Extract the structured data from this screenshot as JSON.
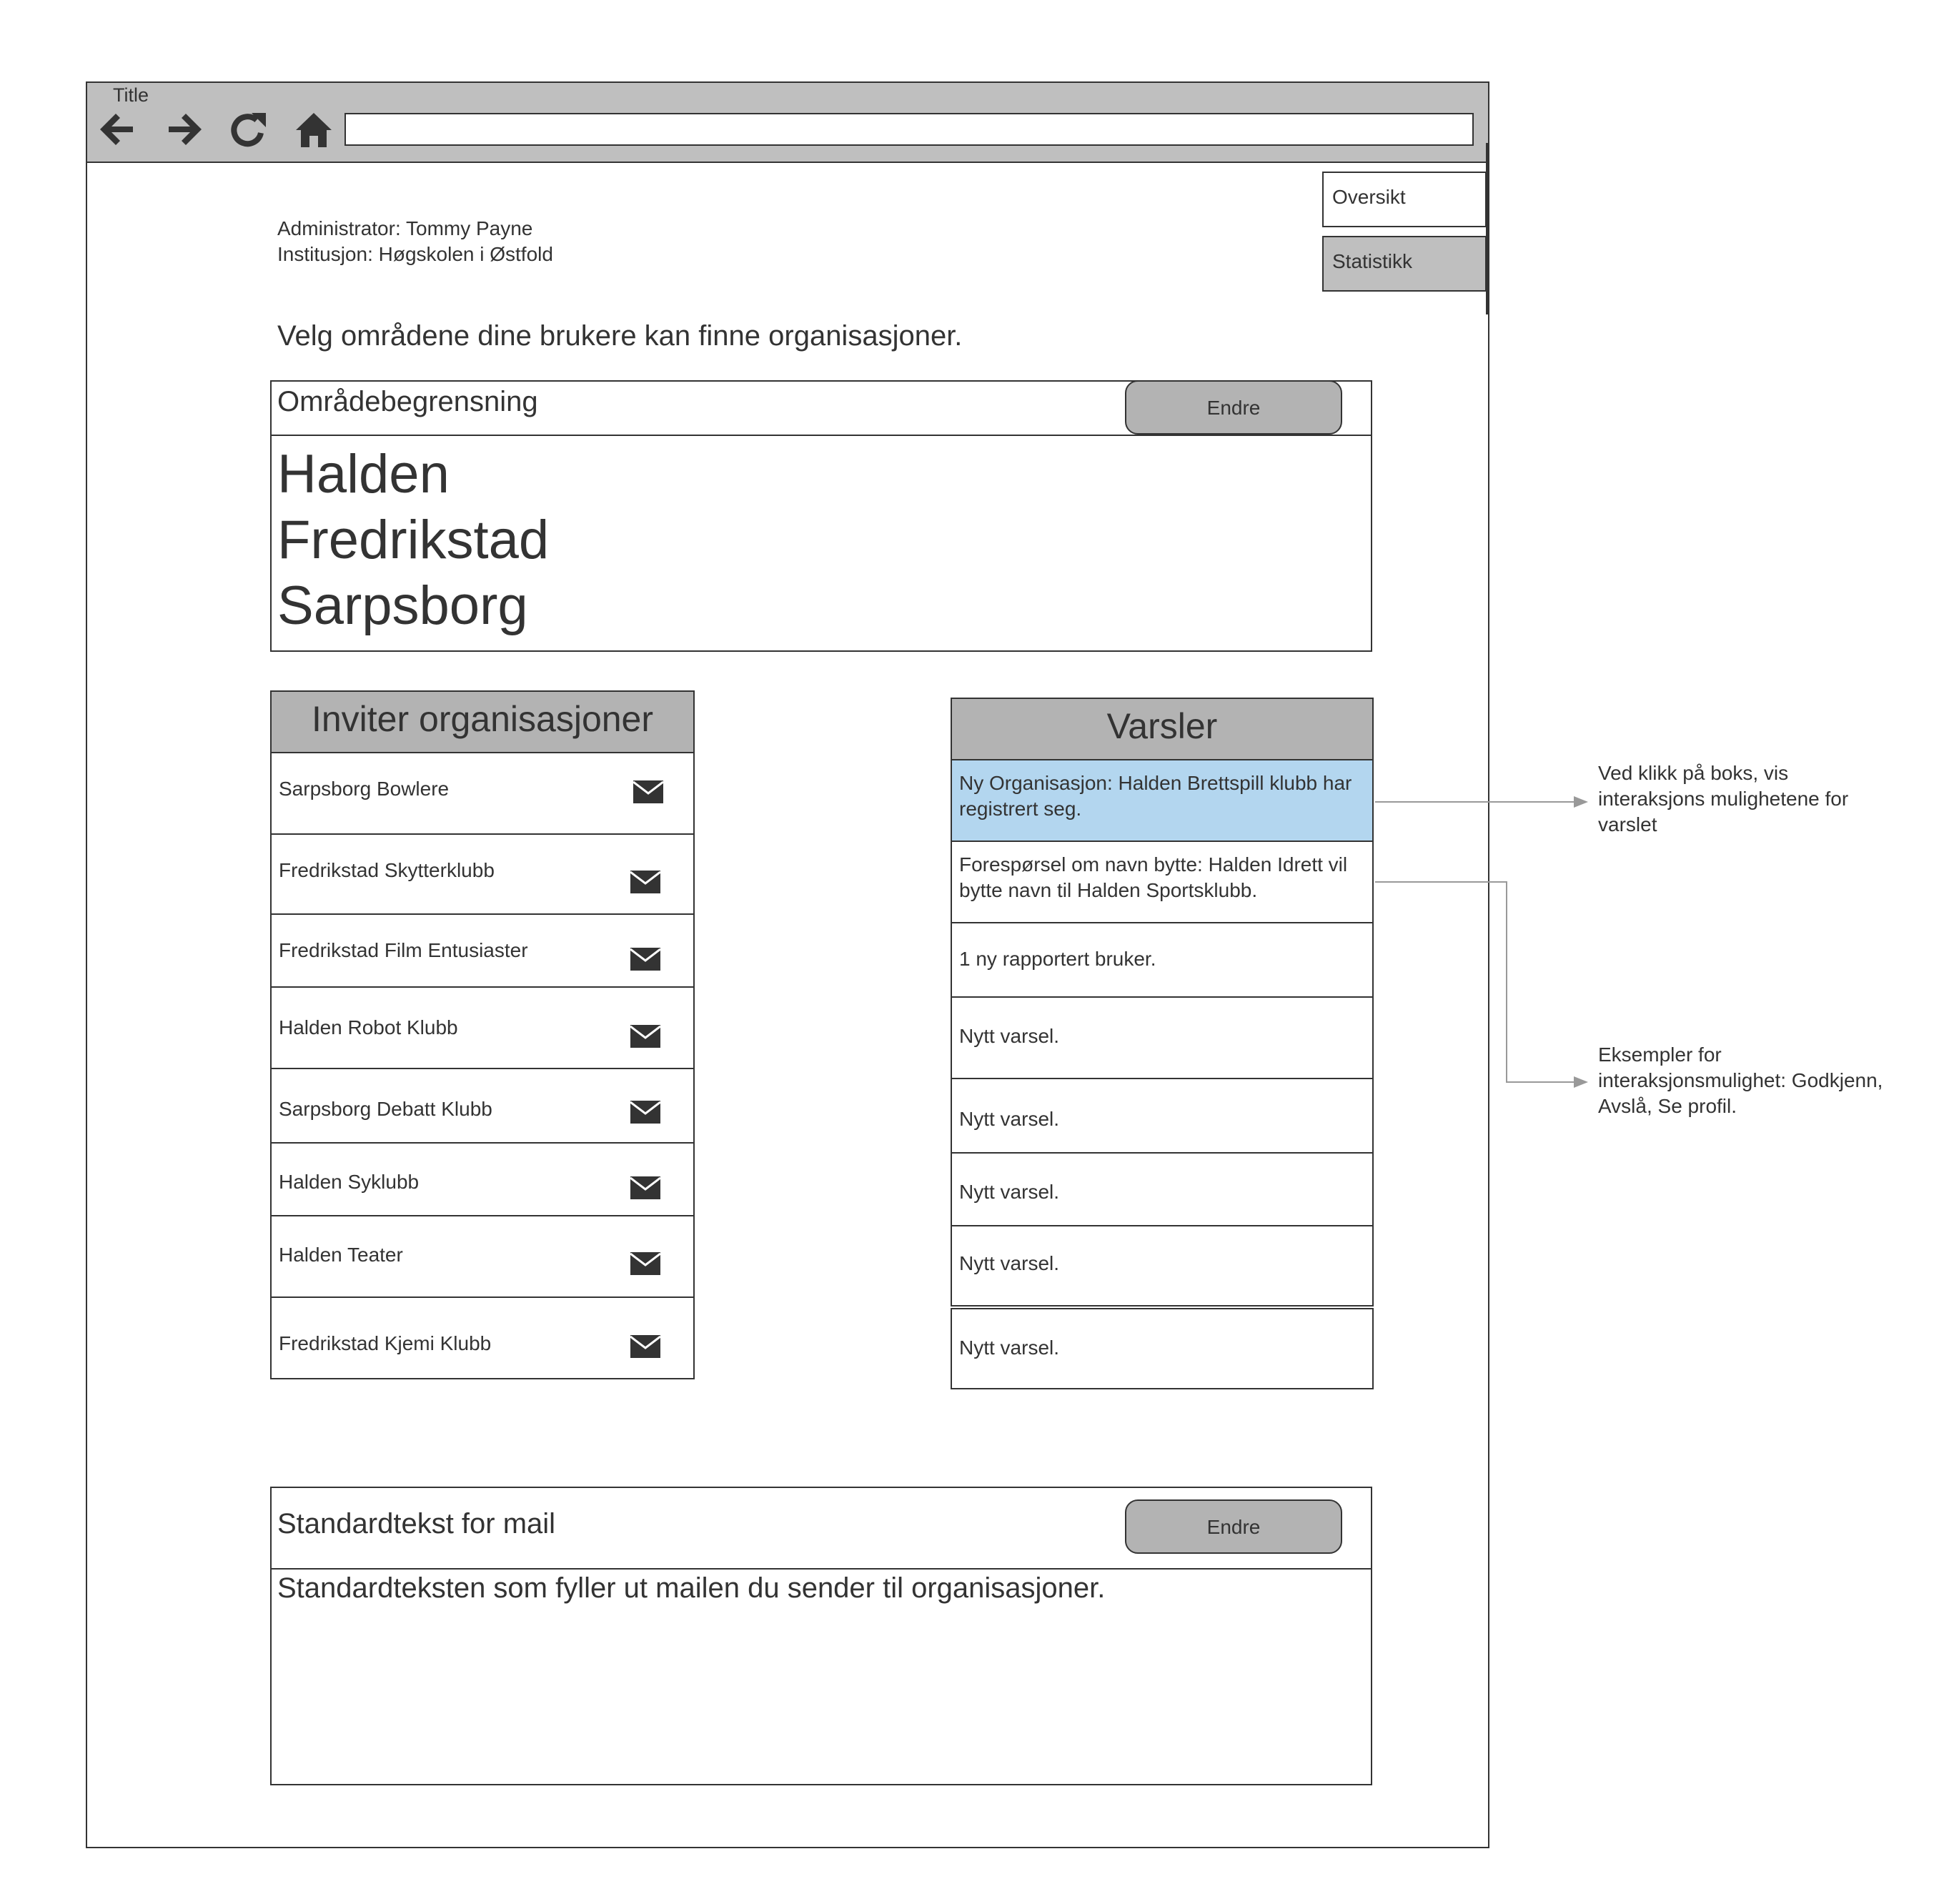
{
  "browser": {
    "title": "Title",
    "url": ""
  },
  "tabs": {
    "overview": "Oversikt",
    "statistics": "Statistikk"
  },
  "admin": {
    "administrator": "Administrator: Tommy Payne",
    "institution": "Institusjon: Høgskolen i Østfold"
  },
  "heading": "Velg områdene dine brukere kan finne organisasjoner.",
  "area": {
    "title": "Områdebegrensning",
    "edit_label": "Endre",
    "places": [
      "Halden",
      "Fredrikstad",
      "Sarpsborg"
    ]
  },
  "invite": {
    "title": "Inviter organisasjoner",
    "orgs": [
      "Sarpsborg Bowlere",
      "Fredrikstad Skytterklubb",
      "Fredrikstad Film Entusiaster",
      "Halden Robot Klubb",
      "Sarpsborg Debatt Klubb",
      "Halden Syklubb",
      "Halden Teater",
      "Fredrikstad Kjemi Klubb"
    ]
  },
  "notifications": {
    "title": "Varsler",
    "items": [
      "Ny Organisasjon: Halden Brettspill klubb har registrert seg.",
      "Forespørsel om navn bytte: Halden Idrett vil bytte navn til Halden Sportsklubb.",
      "1 ny rapportert bruker.",
      "Nytt varsel.",
      "Nytt varsel.",
      "Nytt varsel.",
      "Nytt varsel.",
      "Nytt varsel."
    ],
    "highlight_color": "#b3d6ef"
  },
  "annotations": {
    "click_note": "Ved klikk på boks, vis interaksjons mulighetene for varslet",
    "examples_note": "Eksempler for interaksjonsmulighet: Godkjenn, Avslå, Se profil."
  },
  "mail": {
    "title": "Standardtekst for mail",
    "edit_label": "Endre",
    "body": "Standardteksten som fyller ut mailen du sender til organisasjoner."
  }
}
